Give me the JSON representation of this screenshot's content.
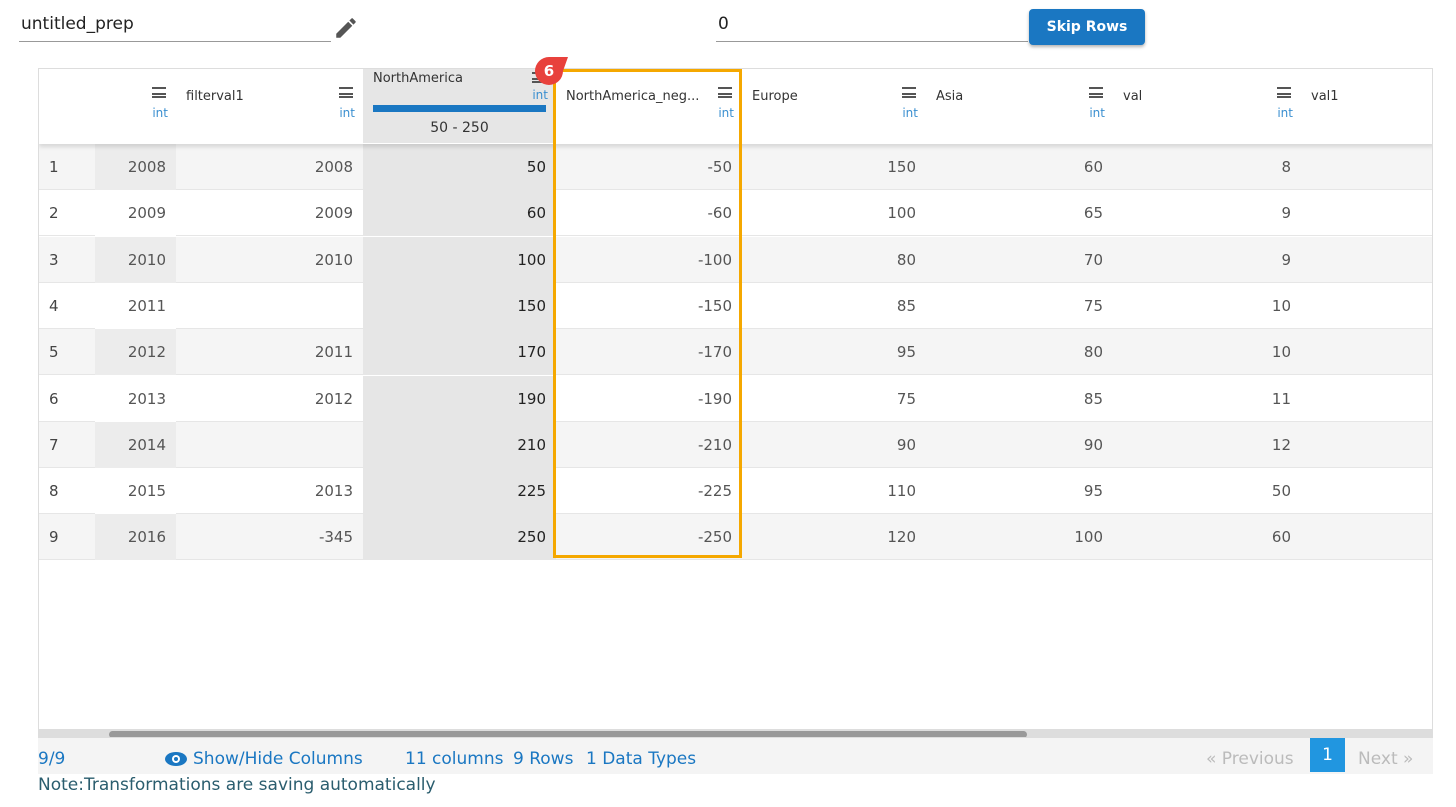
{
  "top": {
    "name_value": "untitled_prep",
    "skip_value": "0",
    "skip_button": "Skip Rows"
  },
  "columns": [
    {
      "name": "",
      "type": "int"
    },
    {
      "name": "filterval1",
      "type": "int"
    },
    {
      "name": "NorthAmerica",
      "type": "int",
      "range": "50 - 250"
    },
    {
      "name": "NorthAmerica_neg...",
      "type": "int"
    },
    {
      "name": "Europe",
      "type": "int"
    },
    {
      "name": "Asia",
      "type": "int"
    },
    {
      "name": "val",
      "type": "int"
    },
    {
      "name": "val1",
      "type": ""
    }
  ],
  "rows": [
    [
      "1",
      "2008",
      "2008",
      "50",
      "-50",
      "150",
      "60",
      "8",
      ""
    ],
    [
      "2",
      "2009",
      "2009",
      "60",
      "-60",
      "100",
      "65",
      "9",
      ""
    ],
    [
      "3",
      "2010",
      "2010",
      "100",
      "-100",
      "80",
      "70",
      "9",
      ""
    ],
    [
      "4",
      "2011",
      "",
      "150",
      "-150",
      "85",
      "75",
      "10",
      ""
    ],
    [
      "5",
      "2012",
      "2011",
      "170",
      "-170",
      "95",
      "80",
      "10",
      ""
    ],
    [
      "6",
      "2013",
      "2012",
      "190",
      "-190",
      "75",
      "85",
      "11",
      ""
    ],
    [
      "7",
      "2014",
      "",
      "210",
      "-210",
      "90",
      "90",
      "12",
      ""
    ],
    [
      "8",
      "2015",
      "2013",
      "225",
      "-225",
      "110",
      "95",
      "50",
      ""
    ],
    [
      "9",
      "2016",
      "-345",
      "250",
      "-250",
      "120",
      "100",
      "60",
      ""
    ]
  ],
  "badge": "6",
  "footer": {
    "count": "9/9",
    "show_hide": "Show/Hide Columns",
    "columns": "11 columns",
    "rows": "9 Rows",
    "types": "1 Data Types",
    "previous": "« Previous",
    "page": "1",
    "next": "Next »"
  },
  "note": "Note:Transformations are saving automatically",
  "colors": {
    "accent": "#1a77c2",
    "highlight": "#f5a800",
    "badge": "#e8413c"
  }
}
